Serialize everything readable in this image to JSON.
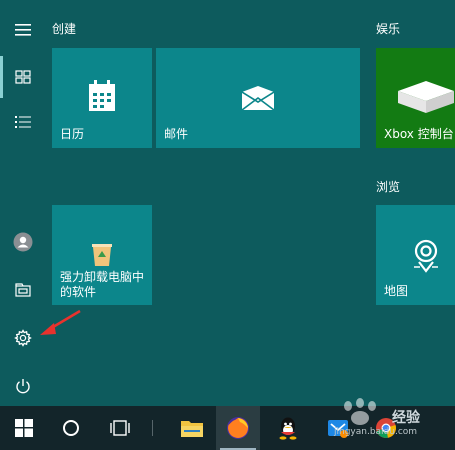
{
  "groups": {
    "create_label": "创建",
    "entertainment_label": "娱乐",
    "browse_label": "浏览"
  },
  "tiles": {
    "calendar": "日历",
    "mail": "邮件",
    "xbox": "Xbox 控制台...",
    "uninstaller_line1": "强力卸载电脑中",
    "uninstaller_line2": "的软件",
    "maps": "地图"
  },
  "watermark": {
    "brand": "经验",
    "url": "jingyan.baidu.com"
  },
  "icons": [
    "hamburger-menu-icon",
    "tiles-icon",
    "list-icon",
    "user-icon",
    "documents-icon",
    "settings-icon",
    "power-icon",
    "windows-icon",
    "cortana-icon",
    "task-view-icon",
    "file-explorer-icon",
    "firefox-icon",
    "qq-icon",
    "email-app-icon",
    "chrome-icon"
  ],
  "colors": {
    "start_background": "#0d5b5d",
    "tile": "#0c868b",
    "xbox_tile": "#137b13",
    "taskbar": "#13252a",
    "annotation_arrow": "#e8322d"
  }
}
